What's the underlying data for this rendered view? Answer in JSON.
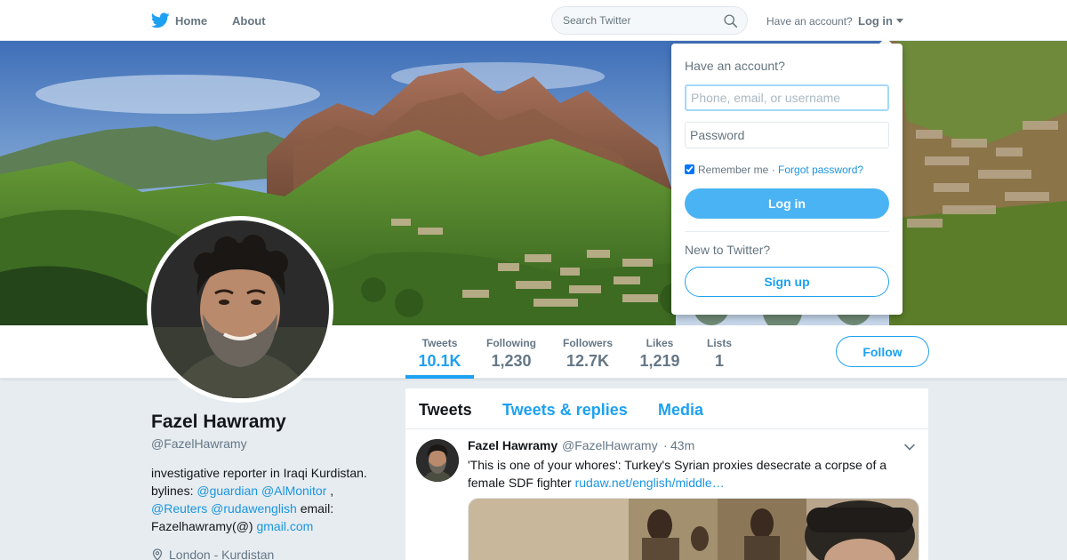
{
  "nav": {
    "home_label": "Home",
    "about_label": "About",
    "search_placeholder": "Search Twitter",
    "have_account": "Have an account?",
    "login_label": "Log in"
  },
  "profile": {
    "name": "Fazel Hawramy",
    "handle": "@FazelHawramy",
    "bio": {
      "line1": "investigative reporter in Iraqi Kurdistan.",
      "bylines": "bylines:",
      "mention1": "@guardian",
      "mention2": "@AlMonitor",
      "comma": ",",
      "mention3": "@Reuters",
      "mention4": "@rudawenglish",
      "email_label": "email:",
      "email_user": "Fazelhawramy(@)",
      "email_domain": "gmail.com"
    },
    "location": "London - Kurdistan"
  },
  "stats": [
    {
      "label": "Tweets",
      "value": "10.1K"
    },
    {
      "label": "Following",
      "value": "1,230"
    },
    {
      "label": "Followers",
      "value": "12.7K"
    },
    {
      "label": "Likes",
      "value": "1,219"
    },
    {
      "label": "Lists",
      "value": "1"
    }
  ],
  "follow_label": "Follow",
  "timeline": {
    "tabs": [
      "Tweets",
      "Tweets & replies",
      "Media"
    ],
    "tweet": {
      "name": "Fazel Hawramy",
      "handle": "@FazelHawramy",
      "separator": "·",
      "time": "43m",
      "text": "'This is one of your whores': Turkey's Syrian proxies desecrate a corpse of a female SDF fighter",
      "link": "rudaw.net/english/middle…"
    }
  },
  "login_dropdown": {
    "title": "Have an account?",
    "username_placeholder": "Phone, email, or username",
    "password_placeholder": "Password",
    "remember_label": "Remember me",
    "separator": "·",
    "forgot_label": "Forgot password?",
    "login_button": "Log in",
    "new_to_twitter": "New to Twitter?",
    "signup_button": "Sign up"
  },
  "colors": {
    "brand_blue": "#1da1f2",
    "link_blue": "#1b95e0",
    "background": "#e6ecf0",
    "muted_text": "#657786"
  },
  "icons": [
    "twitter-bird-icon",
    "search-icon",
    "chevron-down-icon",
    "location-pin-icon"
  ]
}
